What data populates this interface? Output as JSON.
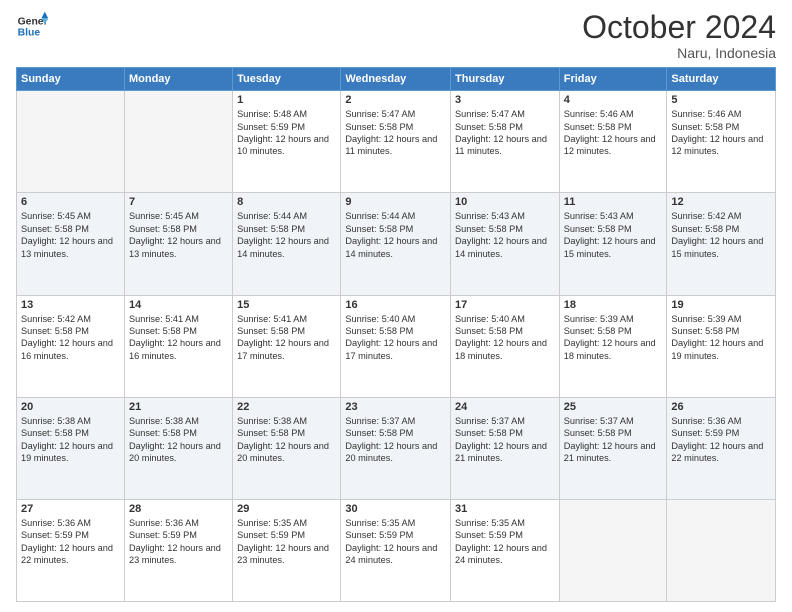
{
  "header": {
    "logo_line1": "General",
    "logo_line2": "Blue",
    "month_title": "October 2024",
    "location": "Naru, Indonesia"
  },
  "days_of_week": [
    "Sunday",
    "Monday",
    "Tuesday",
    "Wednesday",
    "Thursday",
    "Friday",
    "Saturday"
  ],
  "weeks": [
    [
      {
        "num": "",
        "info": ""
      },
      {
        "num": "",
        "info": ""
      },
      {
        "num": "1",
        "info": "Sunrise: 5:48 AM\nSunset: 5:59 PM\nDaylight: 12 hours and 10 minutes."
      },
      {
        "num": "2",
        "info": "Sunrise: 5:47 AM\nSunset: 5:58 PM\nDaylight: 12 hours and 11 minutes."
      },
      {
        "num": "3",
        "info": "Sunrise: 5:47 AM\nSunset: 5:58 PM\nDaylight: 12 hours and 11 minutes."
      },
      {
        "num": "4",
        "info": "Sunrise: 5:46 AM\nSunset: 5:58 PM\nDaylight: 12 hours and 12 minutes."
      },
      {
        "num": "5",
        "info": "Sunrise: 5:46 AM\nSunset: 5:58 PM\nDaylight: 12 hours and 12 minutes."
      }
    ],
    [
      {
        "num": "6",
        "info": "Sunrise: 5:45 AM\nSunset: 5:58 PM\nDaylight: 12 hours and 13 minutes."
      },
      {
        "num": "7",
        "info": "Sunrise: 5:45 AM\nSunset: 5:58 PM\nDaylight: 12 hours and 13 minutes."
      },
      {
        "num": "8",
        "info": "Sunrise: 5:44 AM\nSunset: 5:58 PM\nDaylight: 12 hours and 14 minutes."
      },
      {
        "num": "9",
        "info": "Sunrise: 5:44 AM\nSunset: 5:58 PM\nDaylight: 12 hours and 14 minutes."
      },
      {
        "num": "10",
        "info": "Sunrise: 5:43 AM\nSunset: 5:58 PM\nDaylight: 12 hours and 14 minutes."
      },
      {
        "num": "11",
        "info": "Sunrise: 5:43 AM\nSunset: 5:58 PM\nDaylight: 12 hours and 15 minutes."
      },
      {
        "num": "12",
        "info": "Sunrise: 5:42 AM\nSunset: 5:58 PM\nDaylight: 12 hours and 15 minutes."
      }
    ],
    [
      {
        "num": "13",
        "info": "Sunrise: 5:42 AM\nSunset: 5:58 PM\nDaylight: 12 hours and 16 minutes."
      },
      {
        "num": "14",
        "info": "Sunrise: 5:41 AM\nSunset: 5:58 PM\nDaylight: 12 hours and 16 minutes."
      },
      {
        "num": "15",
        "info": "Sunrise: 5:41 AM\nSunset: 5:58 PM\nDaylight: 12 hours and 17 minutes."
      },
      {
        "num": "16",
        "info": "Sunrise: 5:40 AM\nSunset: 5:58 PM\nDaylight: 12 hours and 17 minutes."
      },
      {
        "num": "17",
        "info": "Sunrise: 5:40 AM\nSunset: 5:58 PM\nDaylight: 12 hours and 18 minutes."
      },
      {
        "num": "18",
        "info": "Sunrise: 5:39 AM\nSunset: 5:58 PM\nDaylight: 12 hours and 18 minutes."
      },
      {
        "num": "19",
        "info": "Sunrise: 5:39 AM\nSunset: 5:58 PM\nDaylight: 12 hours and 19 minutes."
      }
    ],
    [
      {
        "num": "20",
        "info": "Sunrise: 5:38 AM\nSunset: 5:58 PM\nDaylight: 12 hours and 19 minutes."
      },
      {
        "num": "21",
        "info": "Sunrise: 5:38 AM\nSunset: 5:58 PM\nDaylight: 12 hours and 20 minutes."
      },
      {
        "num": "22",
        "info": "Sunrise: 5:38 AM\nSunset: 5:58 PM\nDaylight: 12 hours and 20 minutes."
      },
      {
        "num": "23",
        "info": "Sunrise: 5:37 AM\nSunset: 5:58 PM\nDaylight: 12 hours and 20 minutes."
      },
      {
        "num": "24",
        "info": "Sunrise: 5:37 AM\nSunset: 5:58 PM\nDaylight: 12 hours and 21 minutes."
      },
      {
        "num": "25",
        "info": "Sunrise: 5:37 AM\nSunset: 5:58 PM\nDaylight: 12 hours and 21 minutes."
      },
      {
        "num": "26",
        "info": "Sunrise: 5:36 AM\nSunset: 5:59 PM\nDaylight: 12 hours and 22 minutes."
      }
    ],
    [
      {
        "num": "27",
        "info": "Sunrise: 5:36 AM\nSunset: 5:59 PM\nDaylight: 12 hours and 22 minutes."
      },
      {
        "num": "28",
        "info": "Sunrise: 5:36 AM\nSunset: 5:59 PM\nDaylight: 12 hours and 23 minutes."
      },
      {
        "num": "29",
        "info": "Sunrise: 5:35 AM\nSunset: 5:59 PM\nDaylight: 12 hours and 23 minutes."
      },
      {
        "num": "30",
        "info": "Sunrise: 5:35 AM\nSunset: 5:59 PM\nDaylight: 12 hours and 24 minutes."
      },
      {
        "num": "31",
        "info": "Sunrise: 5:35 AM\nSunset: 5:59 PM\nDaylight: 12 hours and 24 minutes."
      },
      {
        "num": "",
        "info": ""
      },
      {
        "num": "",
        "info": ""
      }
    ]
  ]
}
